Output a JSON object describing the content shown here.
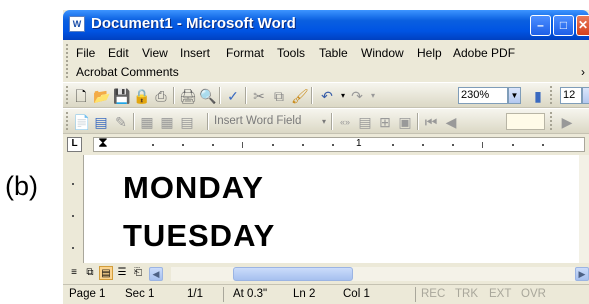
{
  "figure_label": "(b)",
  "window": {
    "title": "Document1 - Microsoft Word",
    "app_icon": "word-doc-icon",
    "title_bar_color": "#0054e3"
  },
  "menu": {
    "row1": [
      {
        "label": "File",
        "name": "menu-file"
      },
      {
        "label": "Edit",
        "name": "menu-edit"
      },
      {
        "label": "View",
        "name": "menu-view"
      },
      {
        "label": "Insert",
        "name": "menu-insert"
      },
      {
        "label": "Format",
        "name": "menu-format"
      },
      {
        "label": "Tools",
        "name": "menu-tools"
      },
      {
        "label": "Table",
        "name": "menu-table"
      },
      {
        "label": "Window",
        "name": "menu-window"
      },
      {
        "label": "Help",
        "name": "menu-help"
      },
      {
        "label": "Adobe PDF",
        "name": "menu-adobe-pdf"
      }
    ],
    "row2": [
      {
        "label": "Acrobat Comments",
        "name": "menu-acrobat-comments"
      }
    ]
  },
  "standard_toolbar": {
    "icons": [
      "new-document-icon",
      "open-folder-icon",
      "save-icon",
      "permission-icon",
      "print-icon",
      "print-preview-icon",
      "spelling-icon",
      "cut-icon",
      "copy-icon",
      "format-painter-icon",
      "undo-icon",
      "redo-icon"
    ],
    "zoom": "230%",
    "font_size": "12"
  },
  "mail_merge_toolbar": {
    "insert_word_field": "Insert Word Field",
    "icons": [
      "main-document-setup-icon",
      "open-data-source-icon",
      "recipients-icon",
      "insert-address-block-icon",
      "insert-greeting-icon",
      "merge-field-icon",
      "view-merged-data-icon",
      "highlight-fields-icon",
      "match-fields-icon",
      "first-record-icon",
      "previous-record-icon",
      "next-record-icon"
    ]
  },
  "ruler": {
    "tab_selector": "L",
    "numbers": [
      "1"
    ]
  },
  "document": {
    "lines": [
      "MONDAY",
      "TUESDAY"
    ]
  },
  "view_buttons": [
    "normal-view-icon",
    "web-layout-view-icon",
    "print-layout-view-icon",
    "outline-view-icon",
    "reading-layout-view-icon"
  ],
  "status": {
    "page": "Page 1",
    "sec": "Sec 1",
    "pages": "1/1",
    "at": "At 0.3\"",
    "ln": "Ln 2",
    "col": "Col 1",
    "rec": "REC",
    "trk": "TRK",
    "ext": "EXT",
    "ovr": "OVR"
  }
}
